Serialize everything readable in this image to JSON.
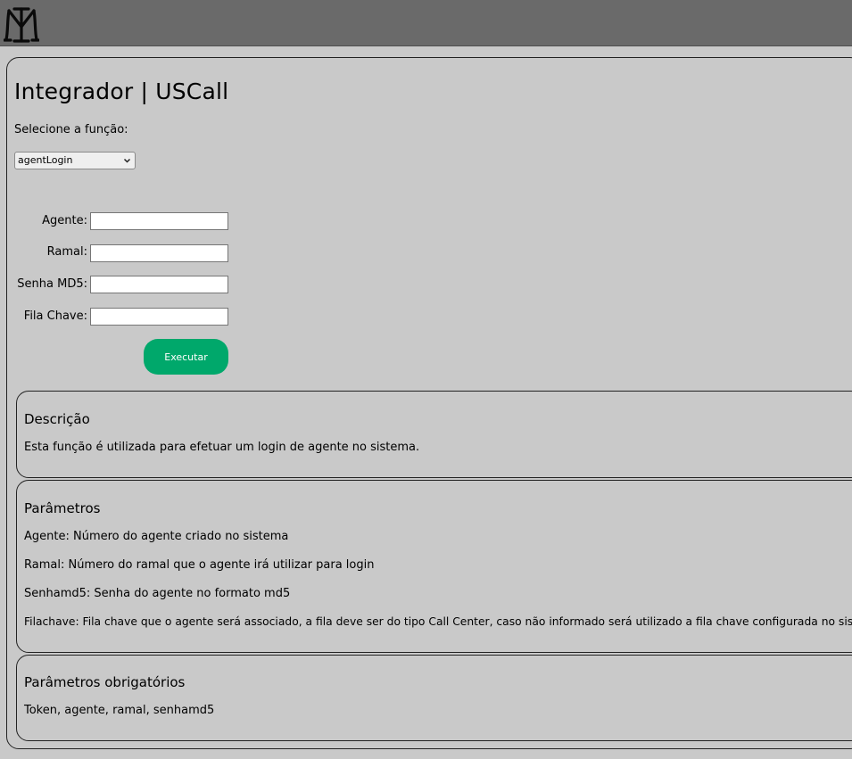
{
  "header": {
    "logo_icon": "monogram-logo"
  },
  "page": {
    "title": "Integrador | USCall",
    "select_label": "Selecione a função:",
    "selected_function": "agentLogin"
  },
  "form": {
    "fields": [
      {
        "label": "Agente:",
        "value": ""
      },
      {
        "label": "Ramal:",
        "value": ""
      },
      {
        "label": "Senha MD5:",
        "value": ""
      },
      {
        "label": "Fila Chave:",
        "value": ""
      }
    ],
    "submit_label": "Executar",
    "submit_color": "#00a86b"
  },
  "description": {
    "heading": "Descrição",
    "text": "Esta função é utilizada para efetuar um login de agente no sistema."
  },
  "parameters": {
    "heading": "Parâmetros",
    "items": [
      "Agente: Número do agente criado no sistema",
      "Ramal: Número do ramal que o agente irá utilizar para login",
      "Senhamd5: Senha do agente no formato md5",
      "Filachave: Fila chave que o agente será associado, a fila deve ser do tipo Call Center, caso não informado será utilizado a fila chave configurada no sistema."
    ]
  },
  "required": {
    "heading": "Parâmetros obrigatórios",
    "text": "Token, agente, ramal, senhamd5"
  }
}
